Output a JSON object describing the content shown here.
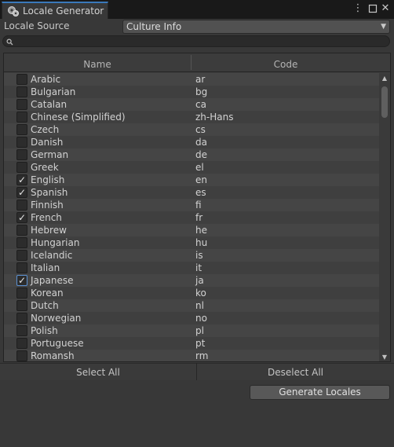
{
  "window": {
    "title": "Locale Generator",
    "menu_icon": "kebab-menu-icon",
    "maximize_icon": "maximize-icon",
    "close_icon": "close-icon"
  },
  "source": {
    "label": "Locale Source",
    "selected": "Culture Info"
  },
  "search": {
    "value": "",
    "placeholder": ""
  },
  "table": {
    "columns": [
      "Name",
      "Code"
    ],
    "rows": [
      {
        "name": "Arabic",
        "code": "ar",
        "checked": false
      },
      {
        "name": "Bulgarian",
        "code": "bg",
        "checked": false
      },
      {
        "name": "Catalan",
        "code": "ca",
        "checked": false
      },
      {
        "name": "Chinese (Simplified)",
        "code": "zh-Hans",
        "checked": false
      },
      {
        "name": "Czech",
        "code": "cs",
        "checked": false
      },
      {
        "name": "Danish",
        "code": "da",
        "checked": false
      },
      {
        "name": "German",
        "code": "de",
        "checked": false
      },
      {
        "name": "Greek",
        "code": "el",
        "checked": false
      },
      {
        "name": "English",
        "code": "en",
        "checked": true
      },
      {
        "name": "Spanish",
        "code": "es",
        "checked": true
      },
      {
        "name": "Finnish",
        "code": "fi",
        "checked": false
      },
      {
        "name": "French",
        "code": "fr",
        "checked": true
      },
      {
        "name": "Hebrew",
        "code": "he",
        "checked": false
      },
      {
        "name": "Hungarian",
        "code": "hu",
        "checked": false
      },
      {
        "name": "Icelandic",
        "code": "is",
        "checked": false
      },
      {
        "name": "Italian",
        "code": "it",
        "checked": false
      },
      {
        "name": "Japanese",
        "code": "ja",
        "checked": true,
        "focused": true
      },
      {
        "name": "Korean",
        "code": "ko",
        "checked": false
      },
      {
        "name": "Dutch",
        "code": "nl",
        "checked": false
      },
      {
        "name": "Norwegian",
        "code": "no",
        "checked": false
      },
      {
        "name": "Polish",
        "code": "pl",
        "checked": false
      },
      {
        "name": "Portuguese",
        "code": "pt",
        "checked": false
      },
      {
        "name": "Romansh",
        "code": "rm",
        "checked": false
      }
    ]
  },
  "buttons": {
    "select_all": "Select All",
    "deselect_all": "Deselect All",
    "generate": "Generate Locales"
  },
  "colors": {
    "accent": "#3a79bb",
    "background": "#383838",
    "check": "#e4e4e4"
  }
}
